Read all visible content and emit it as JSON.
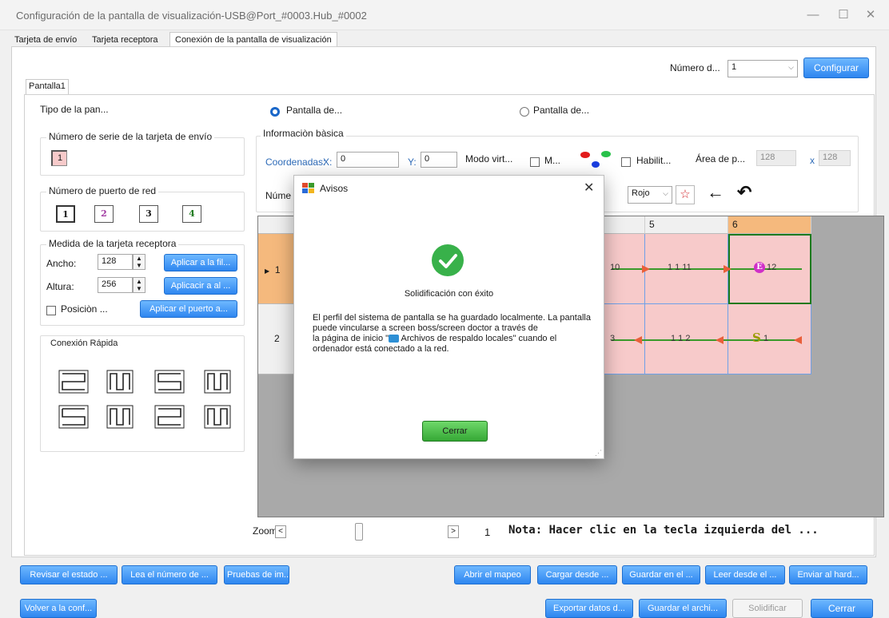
{
  "window": {
    "title": "Configuración de la pantalla de visualización-USB@Port_#0003.Hub_#0002",
    "minimize": "—",
    "maximize": "☐",
    "close": "✕"
  },
  "tabs": [
    {
      "label": "Tarjeta de envío"
    },
    {
      "label": "Tarjeta receptora"
    },
    {
      "label": "Conexión de la pantalla de visualización"
    }
  ],
  "top": {
    "numero_label": "Número d...",
    "numero_value": "1",
    "configurar": "Configurar"
  },
  "screen_tab": "Pantalla1",
  "tipo": {
    "label": "Tipo de la pan...",
    "option1": "Pantalla de...",
    "option2": "Pantalla de..."
  },
  "sender_group": {
    "title": "Número de serie de la tarjeta de envío",
    "value": "1"
  },
  "port_group": {
    "title": "Número de puerto de red",
    "ports": [
      "1",
      "2",
      "3",
      "4"
    ]
  },
  "card_size": {
    "title": "Medida de la tarjeta receptora",
    "ancho_label": "Ancho:",
    "ancho_value": "128",
    "altura_label": "Altura:",
    "altura_value": "256",
    "apply_row": "Aplicar a la fil...",
    "apply_col": "Aplicacir a al ...",
    "position_label": "Posiciòn ...",
    "apply_port": "Aplicar el puerto a..."
  },
  "quick": {
    "title": "Conexión Rápida"
  },
  "basic": {
    "title": "Informaciòn bàsica",
    "coord_label": "Coordenadas:",
    "x_label": "X:",
    "x_value": "0",
    "y_label": "Y:",
    "y_value": "0",
    "modo_label": "Modo virt...",
    "m_label": "M...",
    "habil_label": "Habilit...",
    "area_label": "Área de p...",
    "area_w": "128",
    "area_x": "x",
    "area_h": "128",
    "num_label": "Núme",
    "color_value": "Rojo"
  },
  "grid": {
    "col5": "5",
    "col6": "6",
    "row1": "1",
    "row2": "2",
    "r1c4": "10",
    "r1c5": "1 1 11",
    "r1c6_mark": "E",
    "r1c6_text": "12",
    "r2c4": "3",
    "r2c5": "1 1 2",
    "r2c6_mark": "S",
    "r2c6_text": "1"
  },
  "zoom": {
    "label": "Zoom:",
    "left": "<",
    "right": ">",
    "page": "1",
    "note": "Nota: Hacer clic en la tecla izquierda del ..."
  },
  "buttons_row1": [
    "Revisar el estado ...",
    "Lea el número de ...",
    "Pruebas de im...",
    "Abrir el mapeo",
    "Cargar desde ...",
    "Guardar en el ...",
    "Leer desde el ...",
    "Enviar al hard..."
  ],
  "buttons_row2": {
    "volver": "Volver a la conf...",
    "exportar": "Exportar datos d...",
    "guardar": "Guardar el archi...",
    "solidificar": "Solidificar",
    "cerrar": "Cerrar"
  },
  "dialog": {
    "title": "Avisos",
    "close": "✕",
    "heading": "Solidificación con éxito",
    "body_line1": "El perfil del sistema de pantalla se ha guardado localmente. La pantalla puede vincularse a screen boss/screen doctor a través de",
    "body_line2_pre": "la página de inicio \"",
    "body_line2_link": " Archivos de respaldo locales\" cuando el ordenador está conectado a la red.",
    "button": "Cerrar"
  },
  "colors": {
    "accent": "#2e86f0",
    "cell": "#f7caca",
    "header_orange": "#f5b97d",
    "success": "#38b14a"
  }
}
